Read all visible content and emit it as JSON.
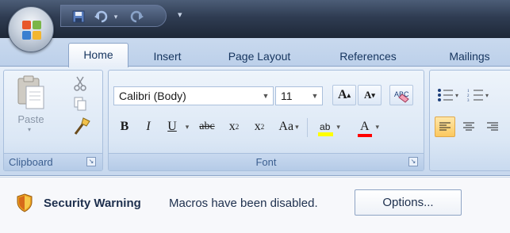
{
  "quick_access": {
    "save_icon": "save-icon",
    "undo_icon": "undo-icon",
    "redo_icon": "redo-icon",
    "customize_icon": "customize-qat-icon"
  },
  "tabs": [
    {
      "label": "Home",
      "active": true
    },
    {
      "label": "Insert",
      "active": false
    },
    {
      "label": "Page Layout",
      "active": false
    },
    {
      "label": "References",
      "active": false
    },
    {
      "label": "Mailings",
      "active": false
    }
  ],
  "clipboard": {
    "paste_label": "Paste",
    "group_label": "Clipboard"
  },
  "font": {
    "font_name": "Calibri (Body)",
    "font_size": "11",
    "group_label": "Font",
    "bold": "B",
    "italic": "I",
    "underline": "U",
    "strike": "abc",
    "subscript_base": "x",
    "subscript_mark": "2",
    "superscript_base": "x",
    "superscript_mark": "2",
    "change_case": "Aa",
    "highlight": "ab",
    "font_color": "A",
    "grow": "A",
    "shrink": "A"
  },
  "security": {
    "title": "Security Warning",
    "message": "Macros have been disabled.",
    "options_label": "Options..."
  },
  "colors": {
    "accent": "#15345e",
    "highlight_yellow": "#ffff00",
    "font_red": "#ff0000"
  }
}
